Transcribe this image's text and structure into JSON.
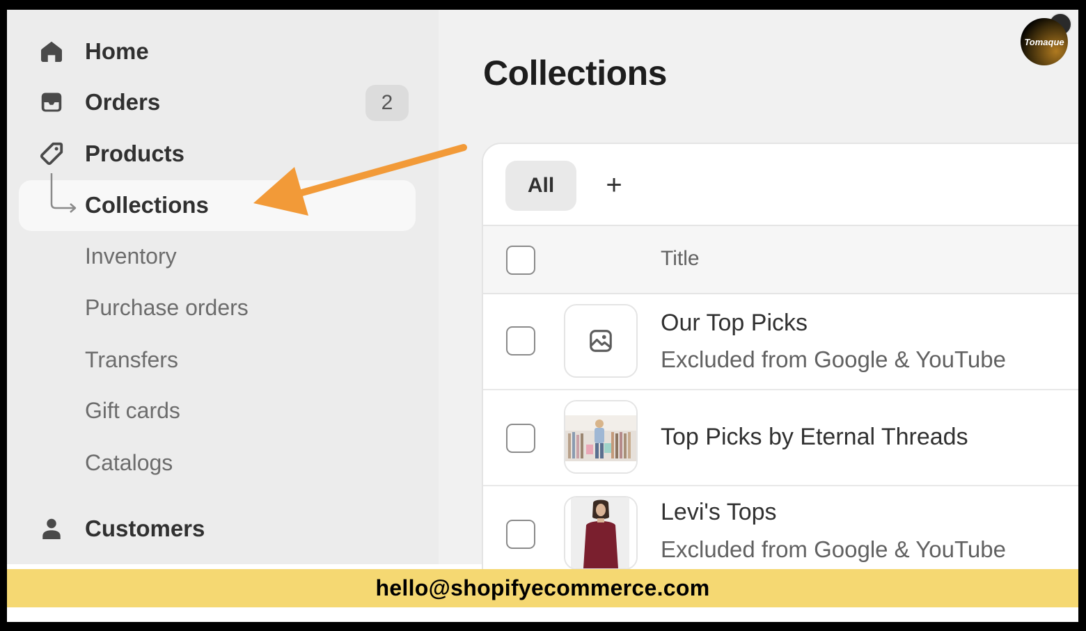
{
  "sidebar": {
    "items": [
      {
        "label": "Home",
        "icon": "home-icon"
      },
      {
        "label": "Orders",
        "icon": "inbox-icon",
        "badge": "2"
      },
      {
        "label": "Products",
        "icon": "tag-icon"
      },
      {
        "label": "Collections",
        "icon": "sub-arrow-icon"
      },
      {
        "label": "Inventory"
      },
      {
        "label": "Purchase orders"
      },
      {
        "label": "Transfers"
      },
      {
        "label": "Gift cards"
      },
      {
        "label": "Catalogs"
      },
      {
        "label": "Customers",
        "icon": "person-icon"
      }
    ]
  },
  "header": {
    "title": "Collections",
    "avatar_text": "Tomaque"
  },
  "tabs": [
    {
      "label": "All"
    },
    {
      "label": "+"
    }
  ],
  "table": {
    "columns": [
      "Title"
    ],
    "rows": [
      {
        "title": "Our Top Picks",
        "subtitle": "Excluded from Google & YouTube",
        "thumbnail": "image-placeholder-icon"
      },
      {
        "title": "Top Picks by Eternal Threads",
        "subtitle": "",
        "thumbnail": "store-photo"
      },
      {
        "title": "Levi's Tops",
        "subtitle": "Excluded from Google & YouTube",
        "thumbnail": "model-photo"
      }
    ]
  },
  "footer": {
    "email": "hello@shopifyecommerce.com"
  },
  "colors": {
    "annotation_arrow": "#f29a38",
    "footer_band": "#f5d872",
    "sidebar_bg": "#ececec"
  }
}
